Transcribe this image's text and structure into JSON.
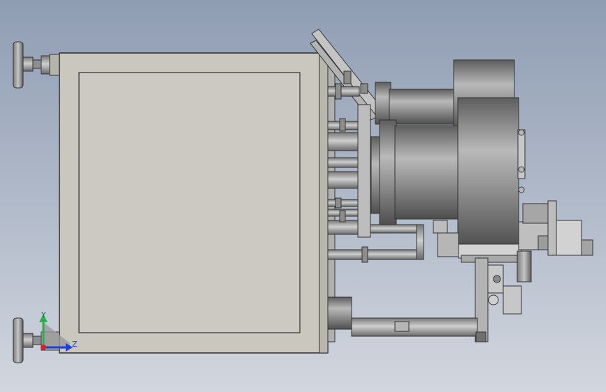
{
  "view": {
    "background_top": "#8f9db3",
    "background_bottom": "#d2d6de"
  },
  "triad": {
    "y_label": "Y",
    "z_label": "Z",
    "y_color": "#22b14c",
    "z_color": "#1f3fd6",
    "x_color": "#e02020"
  },
  "colors": {
    "frame": "#c9c7be",
    "frame_edge": "#3a3a3a",
    "metal_dark": "#6f6f6f",
    "metal_mid": "#a9a9a9",
    "metal_light": "#d8d8d8"
  }
}
